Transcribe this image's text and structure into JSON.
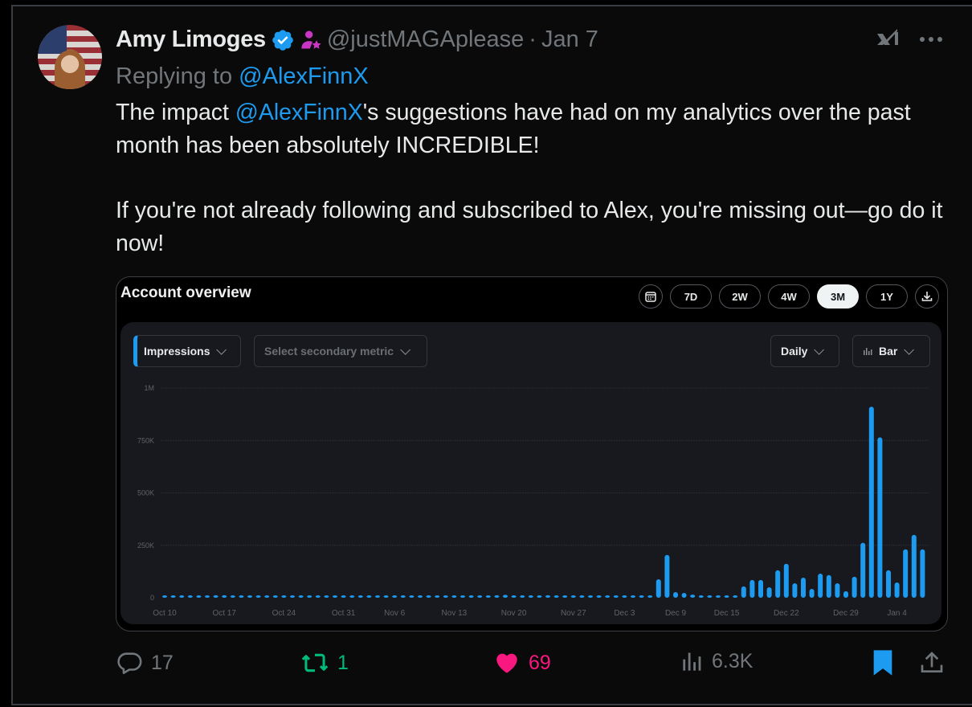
{
  "tweet": {
    "author_name": "Amy Limoges",
    "handle": "@justMAGAplease",
    "separator": "·",
    "date": "Jan 7",
    "replying_prefix": "Replying to",
    "replying_to": "@AlexFinnX",
    "body": {
      "p1_before": "The impact ",
      "p1_mention": "@AlexFinnX",
      "p1_after": "'s suggestions have had on my analytics over the past month has been absolutely INCREDIBLE!",
      "p2": "If you're not already following and subscribed to Alex, you're missing out—go do it now!"
    },
    "icons": {
      "verified": "verified-badge-icon",
      "affiliate": "affiliate-badge-icon",
      "grok": "grok-icon",
      "more": "more-icon"
    },
    "colors": {
      "link": "#1d9bf0",
      "verified": "#1d9bf0",
      "affiliate": "#c936c4",
      "retweet": "#00ba7c",
      "like": "#f91880",
      "bookmark": "#1d9bf0",
      "muted": "#71767b"
    }
  },
  "card": {
    "title": "Account overview",
    "ranges": [
      "7D",
      "2W",
      "4W",
      "3M",
      "1Y"
    ],
    "active_range": "3M",
    "primary_metric": "Impressions",
    "secondary_metric_placeholder": "Select secondary metric",
    "granularity": "Daily",
    "chart_type_label": "Bar"
  },
  "chart_data": {
    "type": "bar",
    "title": "",
    "series_name": "Impressions",
    "color": "#1d9bf0",
    "ylim": [
      0,
      1000000
    ],
    "yticks": [
      0,
      250000,
      500000,
      750000,
      1000000
    ],
    "ytick_labels": [
      "0",
      "250K",
      "500K",
      "750K",
      "1M"
    ],
    "xtick_labels": [
      "Oct 10",
      "Oct 17",
      "Oct 24",
      "Oct 31",
      "Nov 6",
      "Nov 13",
      "Nov 20",
      "Nov 27",
      "Dec 3",
      "Dec 9",
      "Dec 15",
      "Dec 22",
      "Dec 29",
      "Jan 4"
    ],
    "xtick_indices": [
      0,
      7,
      14,
      21,
      27,
      34,
      41,
      48,
      54,
      60,
      66,
      73,
      80,
      86
    ],
    "start_date": "Oct 10",
    "end_date": "Jan 7",
    "grid": true,
    "values": [
      3000,
      3000,
      3000,
      3000,
      8000,
      7000,
      12000,
      12000,
      5000,
      3000,
      3000,
      3000,
      3000,
      3000,
      3000,
      5000,
      3000,
      3000,
      3000,
      3000,
      3000,
      3000,
      3000,
      3000,
      4000,
      4000,
      3000,
      7000,
      8000,
      3000,
      3000,
      3000,
      3000,
      4000,
      3000,
      3000,
      4000,
      3000,
      4000,
      12000,
      14000,
      6000,
      5000,
      4000,
      9000,
      12000,
      7000,
      3000,
      3000,
      3000,
      3000,
      3000,
      3000,
      3000,
      3000,
      3000,
      4000,
      6000,
      88000,
      204000,
      27000,
      23000,
      15000,
      8000,
      8000,
      5000,
      4000,
      7000,
      54000,
      85000,
      85000,
      50000,
      131000,
      162000,
      69000,
      96000,
      42000,
      115000,
      108000,
      69000,
      31000,
      100000,
      262000,
      911000,
      765000,
      131000,
      73000,
      231000,
      300000,
      231000
    ]
  },
  "actions": {
    "replies": "17",
    "reposts": "1",
    "likes": "69",
    "views": "6.3K"
  }
}
